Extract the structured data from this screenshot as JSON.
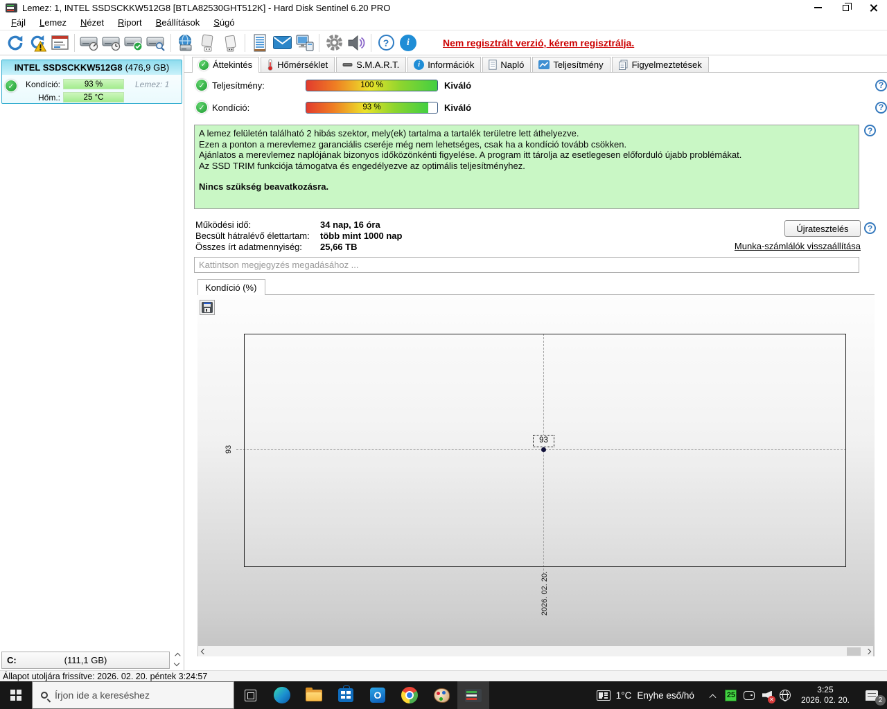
{
  "window_title": "Lemez: 1, INTEL SSDSCKKW512G8 [BTLA82530GHT512K]  -  Hard Disk Sentinel 6.20 PRO",
  "menu": {
    "items": [
      "Fájl",
      "Lemez",
      "Nézet",
      "Riport",
      "Beállítások",
      "Súgó"
    ]
  },
  "toolbar": {
    "register_link": "Nem regisztrált verzió, kérem regisztrálja."
  },
  "sidebar": {
    "disk_name": "INTEL SSDSCKKW512G8",
    "disk_size": "(476,9 GB)",
    "condition_label": "Kondíció:",
    "condition_value": "93 %",
    "disk_number": "Lemez: 1",
    "temperature_label": "Hőm.:",
    "temperature_value": "25 °C",
    "partition_drive": "C:",
    "partition_size": "(111,1 GB)"
  },
  "tabs": [
    {
      "label": "Áttekintés"
    },
    {
      "label": "Hőmérséklet"
    },
    {
      "label": "S.M.A.R.T."
    },
    {
      "label": "Információk"
    },
    {
      "label": "Napló"
    },
    {
      "label": "Teljesítmény"
    },
    {
      "label": "Figyelmeztetések"
    }
  ],
  "overview": {
    "performance_label": "Teljesítmény:",
    "performance_value": "100 %",
    "performance_rating": "Kiváló",
    "performance_percent": 100,
    "condition_label": "Kondíció:",
    "condition_value": "93 %",
    "condition_rating": "Kiváló",
    "condition_percent": 93,
    "message_line1": "A lemez felületén található 2 hibás szektor, mely(ek) tartalma a tartalék területre lett áthelyezve.",
    "message_line2": "Ezen a ponton a merevlemez garanciális cseréje még nem lehetséges, csak ha a kondíció tovább csökken.",
    "message_line3": "Ajánlatos a merevlemez naplójának bizonyos időközönkénti figyelése. A program itt tárolja az esetlegesen előforduló újabb problémákat.",
    "message_line4": "Az SSD TRIM funkciója támogatva és engedélyezve az optimális teljesítményhez.",
    "message_bold": "Nincs szükség beavatkozásra.",
    "stat1_label": "Működési idő:",
    "stat1_value": "34 nap, 16 óra",
    "stat2_label": "Becsült hátralévő élettartam:",
    "stat2_value": "több mint 1000 nap",
    "stat3_label": "Összes írt adatmennyiség:",
    "stat3_value": "25,66 TB",
    "retest_button": "Újratesztelés",
    "reset_counters_link": "Munka-számlálók visszaállítása",
    "comment_placeholder": "Kattintson megjegyzés megadásához ..."
  },
  "chart": {
    "tab_label": "Kondíció  (%)",
    "y_tick": "93",
    "point_label": "93",
    "x_tick": "2026. 02. 20."
  },
  "chart_data": {
    "type": "line",
    "title": "Kondíció  (%)",
    "x": [
      "2026. 02. 20."
    ],
    "series": [
      {
        "name": "Kondíció (%)",
        "values": [
          93
        ]
      }
    ],
    "y_tick_labels": [
      "93"
    ],
    "grid": "dashed crosshair through single data point",
    "legend_position": "none"
  },
  "statusbar": {
    "text": "Állapot utoljára frissítve: 2026. 02. 20. péntek 3:24:57"
  },
  "taskbar": {
    "search_placeholder": "Írjon ide a kereséshez",
    "weather_temp": "1°C",
    "weather_desc": "Enyhe eső/hó",
    "tray_temp_badge": "25",
    "time": "3:25",
    "date": "2026. 02. 20.",
    "notification_count": "2"
  },
  "colors": {
    "accent_green": "#2fb344",
    "meter_border": "#3a5a82",
    "message_bg": "#c9f7c5",
    "register_red": "#cc0000",
    "sidebar_header": "#8fdcee",
    "taskbar_bg": "#171717",
    "tray_temp_bg": "#43d243"
  }
}
